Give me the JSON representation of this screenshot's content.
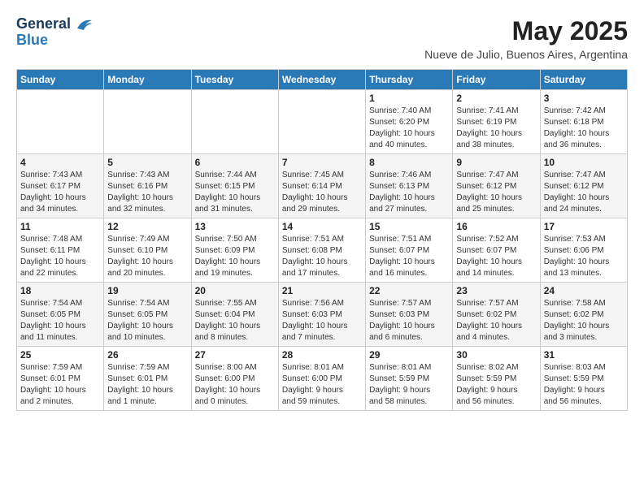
{
  "logo": {
    "line1": "General",
    "line2": "Blue"
  },
  "title": "May 2025",
  "location": "Nueve de Julio, Buenos Aires, Argentina",
  "weekdays": [
    "Sunday",
    "Monday",
    "Tuesday",
    "Wednesday",
    "Thursday",
    "Friday",
    "Saturday"
  ],
  "weeks": [
    [
      {
        "day": "",
        "info": ""
      },
      {
        "day": "",
        "info": ""
      },
      {
        "day": "",
        "info": ""
      },
      {
        "day": "",
        "info": ""
      },
      {
        "day": "1",
        "info": "Sunrise: 7:40 AM\nSunset: 6:20 PM\nDaylight: 10 hours\nand 40 minutes."
      },
      {
        "day": "2",
        "info": "Sunrise: 7:41 AM\nSunset: 6:19 PM\nDaylight: 10 hours\nand 38 minutes."
      },
      {
        "day": "3",
        "info": "Sunrise: 7:42 AM\nSunset: 6:18 PM\nDaylight: 10 hours\nand 36 minutes."
      }
    ],
    [
      {
        "day": "4",
        "info": "Sunrise: 7:43 AM\nSunset: 6:17 PM\nDaylight: 10 hours\nand 34 minutes."
      },
      {
        "day": "5",
        "info": "Sunrise: 7:43 AM\nSunset: 6:16 PM\nDaylight: 10 hours\nand 32 minutes."
      },
      {
        "day": "6",
        "info": "Sunrise: 7:44 AM\nSunset: 6:15 PM\nDaylight: 10 hours\nand 31 minutes."
      },
      {
        "day": "7",
        "info": "Sunrise: 7:45 AM\nSunset: 6:14 PM\nDaylight: 10 hours\nand 29 minutes."
      },
      {
        "day": "8",
        "info": "Sunrise: 7:46 AM\nSunset: 6:13 PM\nDaylight: 10 hours\nand 27 minutes."
      },
      {
        "day": "9",
        "info": "Sunrise: 7:47 AM\nSunset: 6:12 PM\nDaylight: 10 hours\nand 25 minutes."
      },
      {
        "day": "10",
        "info": "Sunrise: 7:47 AM\nSunset: 6:12 PM\nDaylight: 10 hours\nand 24 minutes."
      }
    ],
    [
      {
        "day": "11",
        "info": "Sunrise: 7:48 AM\nSunset: 6:11 PM\nDaylight: 10 hours\nand 22 minutes."
      },
      {
        "day": "12",
        "info": "Sunrise: 7:49 AM\nSunset: 6:10 PM\nDaylight: 10 hours\nand 20 minutes."
      },
      {
        "day": "13",
        "info": "Sunrise: 7:50 AM\nSunset: 6:09 PM\nDaylight: 10 hours\nand 19 minutes."
      },
      {
        "day": "14",
        "info": "Sunrise: 7:51 AM\nSunset: 6:08 PM\nDaylight: 10 hours\nand 17 minutes."
      },
      {
        "day": "15",
        "info": "Sunrise: 7:51 AM\nSunset: 6:07 PM\nDaylight: 10 hours\nand 16 minutes."
      },
      {
        "day": "16",
        "info": "Sunrise: 7:52 AM\nSunset: 6:07 PM\nDaylight: 10 hours\nand 14 minutes."
      },
      {
        "day": "17",
        "info": "Sunrise: 7:53 AM\nSunset: 6:06 PM\nDaylight: 10 hours\nand 13 minutes."
      }
    ],
    [
      {
        "day": "18",
        "info": "Sunrise: 7:54 AM\nSunset: 6:05 PM\nDaylight: 10 hours\nand 11 minutes."
      },
      {
        "day": "19",
        "info": "Sunrise: 7:54 AM\nSunset: 6:05 PM\nDaylight: 10 hours\nand 10 minutes."
      },
      {
        "day": "20",
        "info": "Sunrise: 7:55 AM\nSunset: 6:04 PM\nDaylight: 10 hours\nand 8 minutes."
      },
      {
        "day": "21",
        "info": "Sunrise: 7:56 AM\nSunset: 6:03 PM\nDaylight: 10 hours\nand 7 minutes."
      },
      {
        "day": "22",
        "info": "Sunrise: 7:57 AM\nSunset: 6:03 PM\nDaylight: 10 hours\nand 6 minutes."
      },
      {
        "day": "23",
        "info": "Sunrise: 7:57 AM\nSunset: 6:02 PM\nDaylight: 10 hours\nand 4 minutes."
      },
      {
        "day": "24",
        "info": "Sunrise: 7:58 AM\nSunset: 6:02 PM\nDaylight: 10 hours\nand 3 minutes."
      }
    ],
    [
      {
        "day": "25",
        "info": "Sunrise: 7:59 AM\nSunset: 6:01 PM\nDaylight: 10 hours\nand 2 minutes."
      },
      {
        "day": "26",
        "info": "Sunrise: 7:59 AM\nSunset: 6:01 PM\nDaylight: 10 hours\nand 1 minute."
      },
      {
        "day": "27",
        "info": "Sunrise: 8:00 AM\nSunset: 6:00 PM\nDaylight: 10 hours\nand 0 minutes."
      },
      {
        "day": "28",
        "info": "Sunrise: 8:01 AM\nSunset: 6:00 PM\nDaylight: 9 hours\nand 59 minutes."
      },
      {
        "day": "29",
        "info": "Sunrise: 8:01 AM\nSunset: 5:59 PM\nDaylight: 9 hours\nand 58 minutes."
      },
      {
        "day": "30",
        "info": "Sunrise: 8:02 AM\nSunset: 5:59 PM\nDaylight: 9 hours\nand 56 minutes."
      },
      {
        "day": "31",
        "info": "Sunrise: 8:03 AM\nSunset: 5:59 PM\nDaylight: 9 hours\nand 56 minutes."
      }
    ]
  ]
}
